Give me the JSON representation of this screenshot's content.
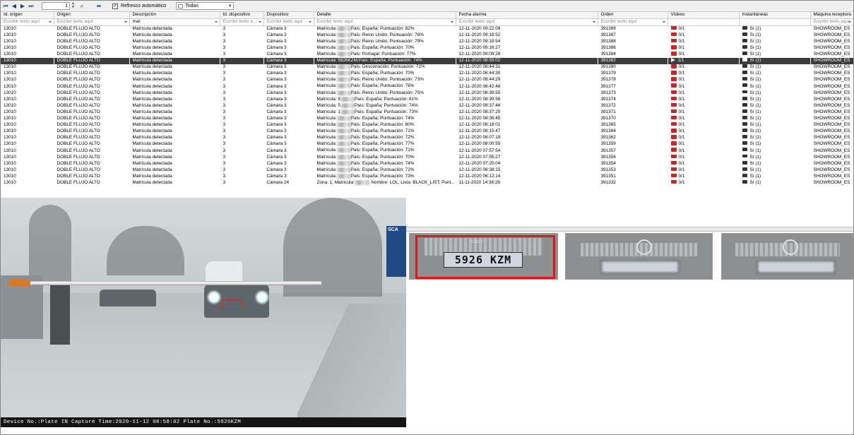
{
  "toolbar": {
    "page_number": "1",
    "auto_refresh_label": "Refresco automático",
    "auto_refresh_checked": "✓",
    "filter_combo_value": "Todas"
  },
  "columns": [
    {
      "label": "Id. origen",
      "filter": "Escribir texto aquí"
    },
    {
      "label": "Origen",
      "filter": "Escribir texto aquí"
    },
    {
      "label": "Descripción",
      "filter": "mat"
    },
    {
      "label": "Id. dispositivo",
      "filter": "Escribir texto a..."
    },
    {
      "label": "Dispositivo",
      "filter": "Escribir texto aquí"
    },
    {
      "label": "Detalle",
      "filter": "Escribir texto aquí"
    },
    {
      "label": "Fecha alarma",
      "filter": "Escribir texto aquí"
    },
    {
      "label": "Orden",
      "filter": "Escribir texto aquí"
    },
    {
      "label": "Vídeos",
      "filter": ""
    },
    {
      "label": "Instantáneas",
      "filter": ""
    },
    {
      "label": "Máquina receptora",
      "filter": "Escribir texto aquí"
    }
  ],
  "rows": [
    {
      "id_origen": "13010",
      "origen": "DOBLE FLUJO ALTO",
      "descripcion": "Matrícula detectada",
      "id_disp": "3",
      "dispositivo": "Cámara 3",
      "detalle_a": "Matrícula:",
      "detalle_b": "País: España;  Puntuación: 82%",
      "fecha": "12-11-2020 09:22:09",
      "orden": "391389",
      "videos": "0/1",
      "inst": "Sí (1)",
      "maquina": "SHOWROOM_ES"
    },
    {
      "id_origen": "13010",
      "origen": "DOBLE FLUJO ALTO",
      "descripcion": "Matrícula detectada",
      "id_disp": "3",
      "dispositivo": "Cámara 3",
      "detalle_a": "Matrícula:",
      "detalle_b": "País: Reino Unido;  Puntuación: 78%",
      "fecha": "12-11-2020 09:18:52",
      "orden": "391387",
      "videos": "0/1",
      "inst": "Sí (1)",
      "maquina": "SHOWROOM_ES"
    },
    {
      "id_origen": "13010",
      "origen": "DOBLE FLUJO ALTO",
      "descripcion": "Matrícula detectada",
      "id_disp": "3",
      "dispositivo": "Cámara 3",
      "detalle_a": "Matrícula:",
      "detalle_b": "País: Reino Unido;  Puntuación: 79%",
      "fecha": "12-11-2020 09:18:54",
      "orden": "391388",
      "videos": "0/1",
      "inst": "Sí (1)",
      "maquina": "SHOWROOM_ES"
    },
    {
      "id_origen": "13010",
      "origen": "DOBLE FLUJO ALTO",
      "descripcion": "Matrícula detectada",
      "id_disp": "3",
      "dispositivo": "Cámara 3",
      "detalle_a": "Matrícula:",
      "detalle_b": "País: España;  Puntuación: 70%",
      "fecha": "12-11-2020 09:16:27",
      "orden": "391386",
      "videos": "0/1",
      "inst": "Sí (1)",
      "maquina": "SHOWROOM_ES"
    },
    {
      "id_origen": "13010",
      "origen": "DOBLE FLUJO ALTO",
      "descripcion": "Matrícula detectada",
      "id_disp": "3",
      "dispositivo": "Cámara 3",
      "detalle_a": "Matrícula:",
      "detalle_b": "País: Portugal;  Puntuación: 77%",
      "fecha": "12-11-2020 09:09:28",
      "orden": "391384",
      "videos": "0/1",
      "inst": "Sí (1)",
      "maquina": "SHOWROOM_ES"
    },
    {
      "id_origen": "13010",
      "origen": "DOBLE FLUJO ALTO",
      "descripcion": "Matrícula detectada",
      "id_disp": "3",
      "dispositivo": "Cámara 3",
      "detalle_a": "Matrícula: 5926KZM;",
      "detalle_b": "País: España;  Puntuación: 74%",
      "fecha": "12-11-2020 08:58:02",
      "orden": "391382",
      "videos": "1/1",
      "inst": "Sí (1)",
      "maquina": "SHOWROOM_ES",
      "selected": true
    },
    {
      "id_origen": "13010",
      "origen": "DOBLE FLUJO ALTO",
      "descripcion": "Matrícula detectada",
      "id_disp": "3",
      "dispositivo": "Cámara 3",
      "detalle_a": "Matrícula:",
      "detalle_b": "País: Desconocido;  Puntuación: 72%",
      "fecha": "12-11-2020 08:44:31",
      "orden": "391380",
      "videos": "0/1",
      "inst": "Sí (1)",
      "maquina": "SHOWROOM_ES"
    },
    {
      "id_origen": "13010",
      "origen": "DOBLE FLUJO ALTO",
      "descripcion": "Matrícula detectada",
      "id_disp": "3",
      "dispositivo": "Cámara 3",
      "detalle_a": "Matrícula:",
      "detalle_b": "País: España;  Puntuación: 70%",
      "fecha": "12-11-2020 08:44:30",
      "orden": "391379",
      "videos": "0/1",
      "inst": "Sí (1)",
      "maquina": "SHOWROOM_ES"
    },
    {
      "id_origen": "13010",
      "origen": "DOBLE FLUJO ALTO",
      "descripcion": "Matrícula detectada",
      "id_disp": "3",
      "dispositivo": "Cámara 3",
      "detalle_a": "Matrícula:",
      "detalle_b": "País: Reino Unido;  Puntuación: 73%",
      "fecha": "12-11-2020 08:44:29",
      "orden": "391378",
      "videos": "0/1",
      "inst": "Sí (1)",
      "maquina": "SHOWROOM_ES"
    },
    {
      "id_origen": "13010",
      "origen": "DOBLE FLUJO ALTO",
      "descripcion": "Matrícula detectada",
      "id_disp": "3",
      "dispositivo": "Cámara 3",
      "detalle_a": "Matrícula:",
      "detalle_b": "País: España;  Puntuación: 76%",
      "fecha": "12-11-2020 08:42:48",
      "orden": "391377",
      "videos": "0/1",
      "inst": "Sí (1)",
      "maquina": "SHOWROOM_ES"
    },
    {
      "id_origen": "13010",
      "origen": "DOBLE FLUJO ALTO",
      "descripcion": "Matrícula detectada",
      "id_disp": "3",
      "dispositivo": "Cámara 3",
      "detalle_a": "Matrícula:",
      "detalle_b": "País: Reino Unido;  Puntuación: 75%",
      "fecha": "12-11-2020 08:39:55",
      "orden": "391373",
      "videos": "0/1",
      "inst": "Sí (1)",
      "maquina": "SHOWROOM_ES"
    },
    {
      "id_origen": "13010",
      "origen": "DOBLE FLUJO ALTO",
      "descripcion": "Matrícula detectada",
      "id_disp": "3",
      "dispositivo": "Cámara 3",
      "detalle_a": "Matrícula: 8",
      "detalle_b": "País: España;  Puntuación: 81%",
      "fecha": "12-11-2020 08:39:56",
      "orden": "391374",
      "videos": "0/1",
      "inst": "Sí (1)",
      "maquina": "SHOWROOM_ES"
    },
    {
      "id_origen": "13010",
      "origen": "DOBLE FLUJO ALTO",
      "descripcion": "Matrícula detectada",
      "id_disp": "3",
      "dispositivo": "Cámara 3",
      "detalle_a": "Matrícula: 5",
      "detalle_b": "País: España;  Puntuación: 74%",
      "fecha": "12-11-2020 08:37:46",
      "orden": "391372",
      "videos": "0/1",
      "inst": "Sí (1)",
      "maquina": "SHOWROOM_ES"
    },
    {
      "id_origen": "13010",
      "origen": "DOBLE FLUJO ALTO",
      "descripcion": "Matrícula detectada",
      "id_disp": "3",
      "dispositivo": "Cámara 3",
      "detalle_a": "Matrícula: 1",
      "detalle_b": "País: España;  Puntuación: 73%",
      "fecha": "12-11-2020 08:37:25",
      "orden": "391371",
      "videos": "0/1",
      "inst": "Sí (1)",
      "maquina": "SHOWROOM_ES"
    },
    {
      "id_origen": "13010",
      "origen": "DOBLE FLUJO ALTO",
      "descripcion": "Matrícula detectada",
      "id_disp": "3",
      "dispositivo": "Cámara 3",
      "detalle_a": "Matrícula:",
      "detalle_b": "País: España;  Puntuación: 74%",
      "fecha": "12-11-2020 08:36:45",
      "orden": "391370",
      "videos": "0/1",
      "inst": "Sí (1)",
      "maquina": "SHOWROOM_ES"
    },
    {
      "id_origen": "13010",
      "origen": "DOBLE FLUJO ALTO",
      "descripcion": "Matrícula detectada",
      "id_disp": "3",
      "dispositivo": "Cámara 3",
      "detalle_a": "Matrícula:",
      "detalle_b": "País: España;  Puntuación: 80%",
      "fecha": "12-11-2020 08:18:01",
      "orden": "391365",
      "videos": "0/1",
      "inst": "Sí (1)",
      "maquina": "SHOWROOM_ES"
    },
    {
      "id_origen": "13010",
      "origen": "DOBLE FLUJO ALTO",
      "descripcion": "Matrícula detectada",
      "id_disp": "3",
      "dispositivo": "Cámara 3",
      "detalle_a": "Matrícula:",
      "detalle_b": "País: España;  Puntuación: 71%",
      "fecha": "12-11-2020 08:15:47",
      "orden": "391364",
      "videos": "0/1",
      "inst": "Sí (1)",
      "maquina": "SHOWROOM_ES"
    },
    {
      "id_origen": "13010",
      "origen": "DOBLE FLUJO ALTO",
      "descripcion": "Matrícula detectada",
      "id_disp": "3",
      "dispositivo": "Cámara 3",
      "detalle_a": "Matrícula:",
      "detalle_b": "País: España;  Puntuación: 72%",
      "fecha": "12-11-2020 08:07:19",
      "orden": "391362",
      "videos": "0/1",
      "inst": "Sí (1)",
      "maquina": "SHOWROOM_ES"
    },
    {
      "id_origen": "13010",
      "origen": "DOBLE FLUJO ALTO",
      "descripcion": "Matrícula detectada",
      "id_disp": "3",
      "dispositivo": "Cámara 3",
      "detalle_a": "Matrícula:",
      "detalle_b": "País: España;  Puntuación: 77%",
      "fecha": "12-11-2020 08:00:55",
      "orden": "391359",
      "videos": "0/1",
      "inst": "Sí (1)",
      "maquina": "SHOWROOM_ES"
    },
    {
      "id_origen": "13010",
      "origen": "DOBLE FLUJO ALTO",
      "descripcion": "Matrícula detectada",
      "id_disp": "3",
      "dispositivo": "Cámara 3",
      "detalle_a": "Matrícula:",
      "detalle_b": "País: España;  Puntuación: 71%",
      "fecha": "12-11-2020 07:57:54",
      "orden": "391357",
      "videos": "0/1",
      "inst": "Sí (1)",
      "maquina": "SHOWROOM_ES"
    },
    {
      "id_origen": "13010",
      "origen": "DOBLE FLUJO ALTO",
      "descripcion": "Matrícula detectada",
      "id_disp": "3",
      "dispositivo": "Cámara 3",
      "detalle_a": "Matrícula:",
      "detalle_b": "País: España;  Puntuación: 70%",
      "fecha": "12-11-2020 07:55:27",
      "orden": "391356",
      "videos": "0/1",
      "inst": "Sí (1)",
      "maquina": "SHOWROOM_ES"
    },
    {
      "id_origen": "13010",
      "origen": "DOBLE FLUJO ALTO",
      "descripcion": "Matrícula detectada",
      "id_disp": "3",
      "dispositivo": "Cámara 3",
      "detalle_a": "Matrícula:",
      "detalle_b": "País: España;  Puntuación: 74%",
      "fecha": "12-11-2020 07:20:04",
      "orden": "391354",
      "videos": "0/1",
      "inst": "Sí (1)",
      "maquina": "SHOWROOM_ES"
    },
    {
      "id_origen": "13010",
      "origen": "DOBLE FLUJO ALTO",
      "descripcion": "Matrícula detectada",
      "id_disp": "3",
      "dispositivo": "Cámara 3",
      "detalle_a": "Matrícula:",
      "detalle_b": "País: España;  Puntuación: 72%",
      "fecha": "12-11-2020 06:38:15",
      "orden": "391353",
      "videos": "0/1",
      "inst": "Sí (1)",
      "maquina": "SHOWROOM_ES"
    },
    {
      "id_origen": "13010",
      "origen": "DOBLE FLUJO ALTO",
      "descripcion": "Matrícula detectada",
      "id_disp": "3",
      "dispositivo": "Cámara 3",
      "detalle_a": "Matrícula:",
      "detalle_b": "País: España;  Puntuación: 73%",
      "fecha": "12-11-2020 06:12:14",
      "orden": "391351",
      "videos": "0/1",
      "inst": "Sí (1)",
      "maquina": "SHOWROOM_ES"
    },
    {
      "id_origen": "13010",
      "origen": "DOBLE FLUJO ALTO",
      "descripcion": "Matrícula detectada",
      "id_disp": "3",
      "dispositivo": "Cámara 24",
      "detalle_a": "Zona: 1; Matrícula:",
      "detalle_b": "; Nombre: LOL; Lista: BLACK_LIST; Punt...",
      "fecha": "11-11-2020 14:38:28",
      "orden": "391332",
      "videos": "0/1",
      "inst": "Sí (1)",
      "maquina": "SHOWROOM_ES"
    }
  ],
  "scene": {
    "osd_text": "Device No.:Plate IN Capture Time:2020-11-12 08:58:02    Plate No.:5926KZM",
    "sign_text": "SCA"
  },
  "thumbnails": {
    "plate_1": "5926 KZM"
  },
  "colors": {
    "selected_row": "#3c3c3c",
    "highlight_box": "#e01818",
    "video_icon": "#c62828"
  }
}
